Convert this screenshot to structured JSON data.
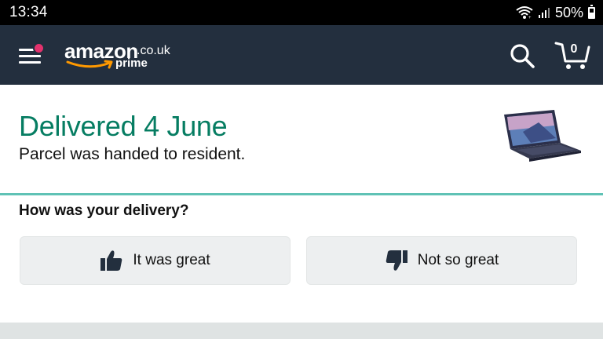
{
  "status_bar": {
    "time": "13:34",
    "battery_text": "50%",
    "battery_level": 0.5,
    "icons": [
      "wifi-icon",
      "signal-icon",
      "battery-icon"
    ]
  },
  "header": {
    "logo": {
      "wordmark": "amazon",
      "tld": ".co.uk",
      "sub": "prime"
    },
    "cart_count": "0",
    "icons": [
      "menu-icon",
      "search-icon",
      "cart-icon"
    ],
    "colors": {
      "background": "#232f3e",
      "notification_dot": "#e3326d",
      "logo_smile": "#ff9900"
    }
  },
  "delivery": {
    "status_title": "Delivered 4 June",
    "status_detail": "Parcel was handed to resident.",
    "title_color": "#067d62",
    "divider_color": "#5fc2b5"
  },
  "feedback": {
    "question": "How was your delivery?",
    "positive_label": "It was great",
    "negative_label": "Not so great",
    "icons": [
      "thumbs-up-icon",
      "thumbs-down-icon"
    ]
  }
}
